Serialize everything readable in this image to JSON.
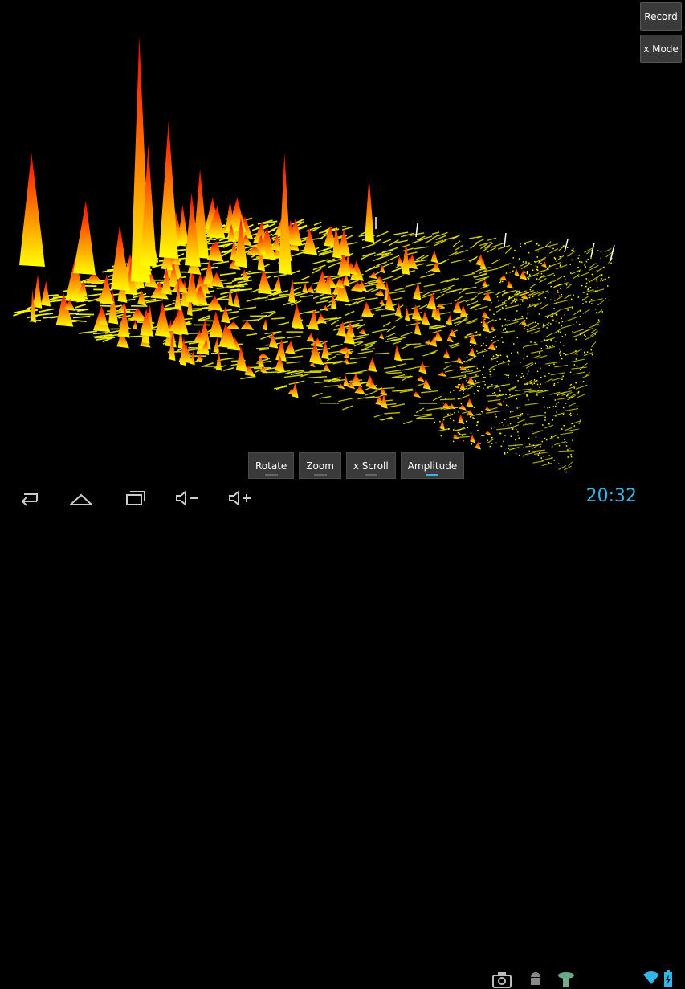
{
  "side_buttons": {
    "record": "Record",
    "x_mode": "x Mode"
  },
  "toolbar": {
    "rotate": "Rotate",
    "zoom": "Zoom",
    "x_scroll": "x Scroll",
    "amplitude": "Amplitude",
    "active": "Amplitude"
  },
  "status": {
    "time": "20:32"
  },
  "colors": {
    "accent": "#33b5e5",
    "peak_high": "#ff0000",
    "peak_low": "#ffff00"
  },
  "icons": [
    "back-icon",
    "home-icon",
    "recent-apps-icon",
    "volume-down-icon",
    "volume-up-icon",
    "camera-icon",
    "android-icon",
    "notification-icon",
    "wifi-icon",
    "battery-icon"
  ]
}
